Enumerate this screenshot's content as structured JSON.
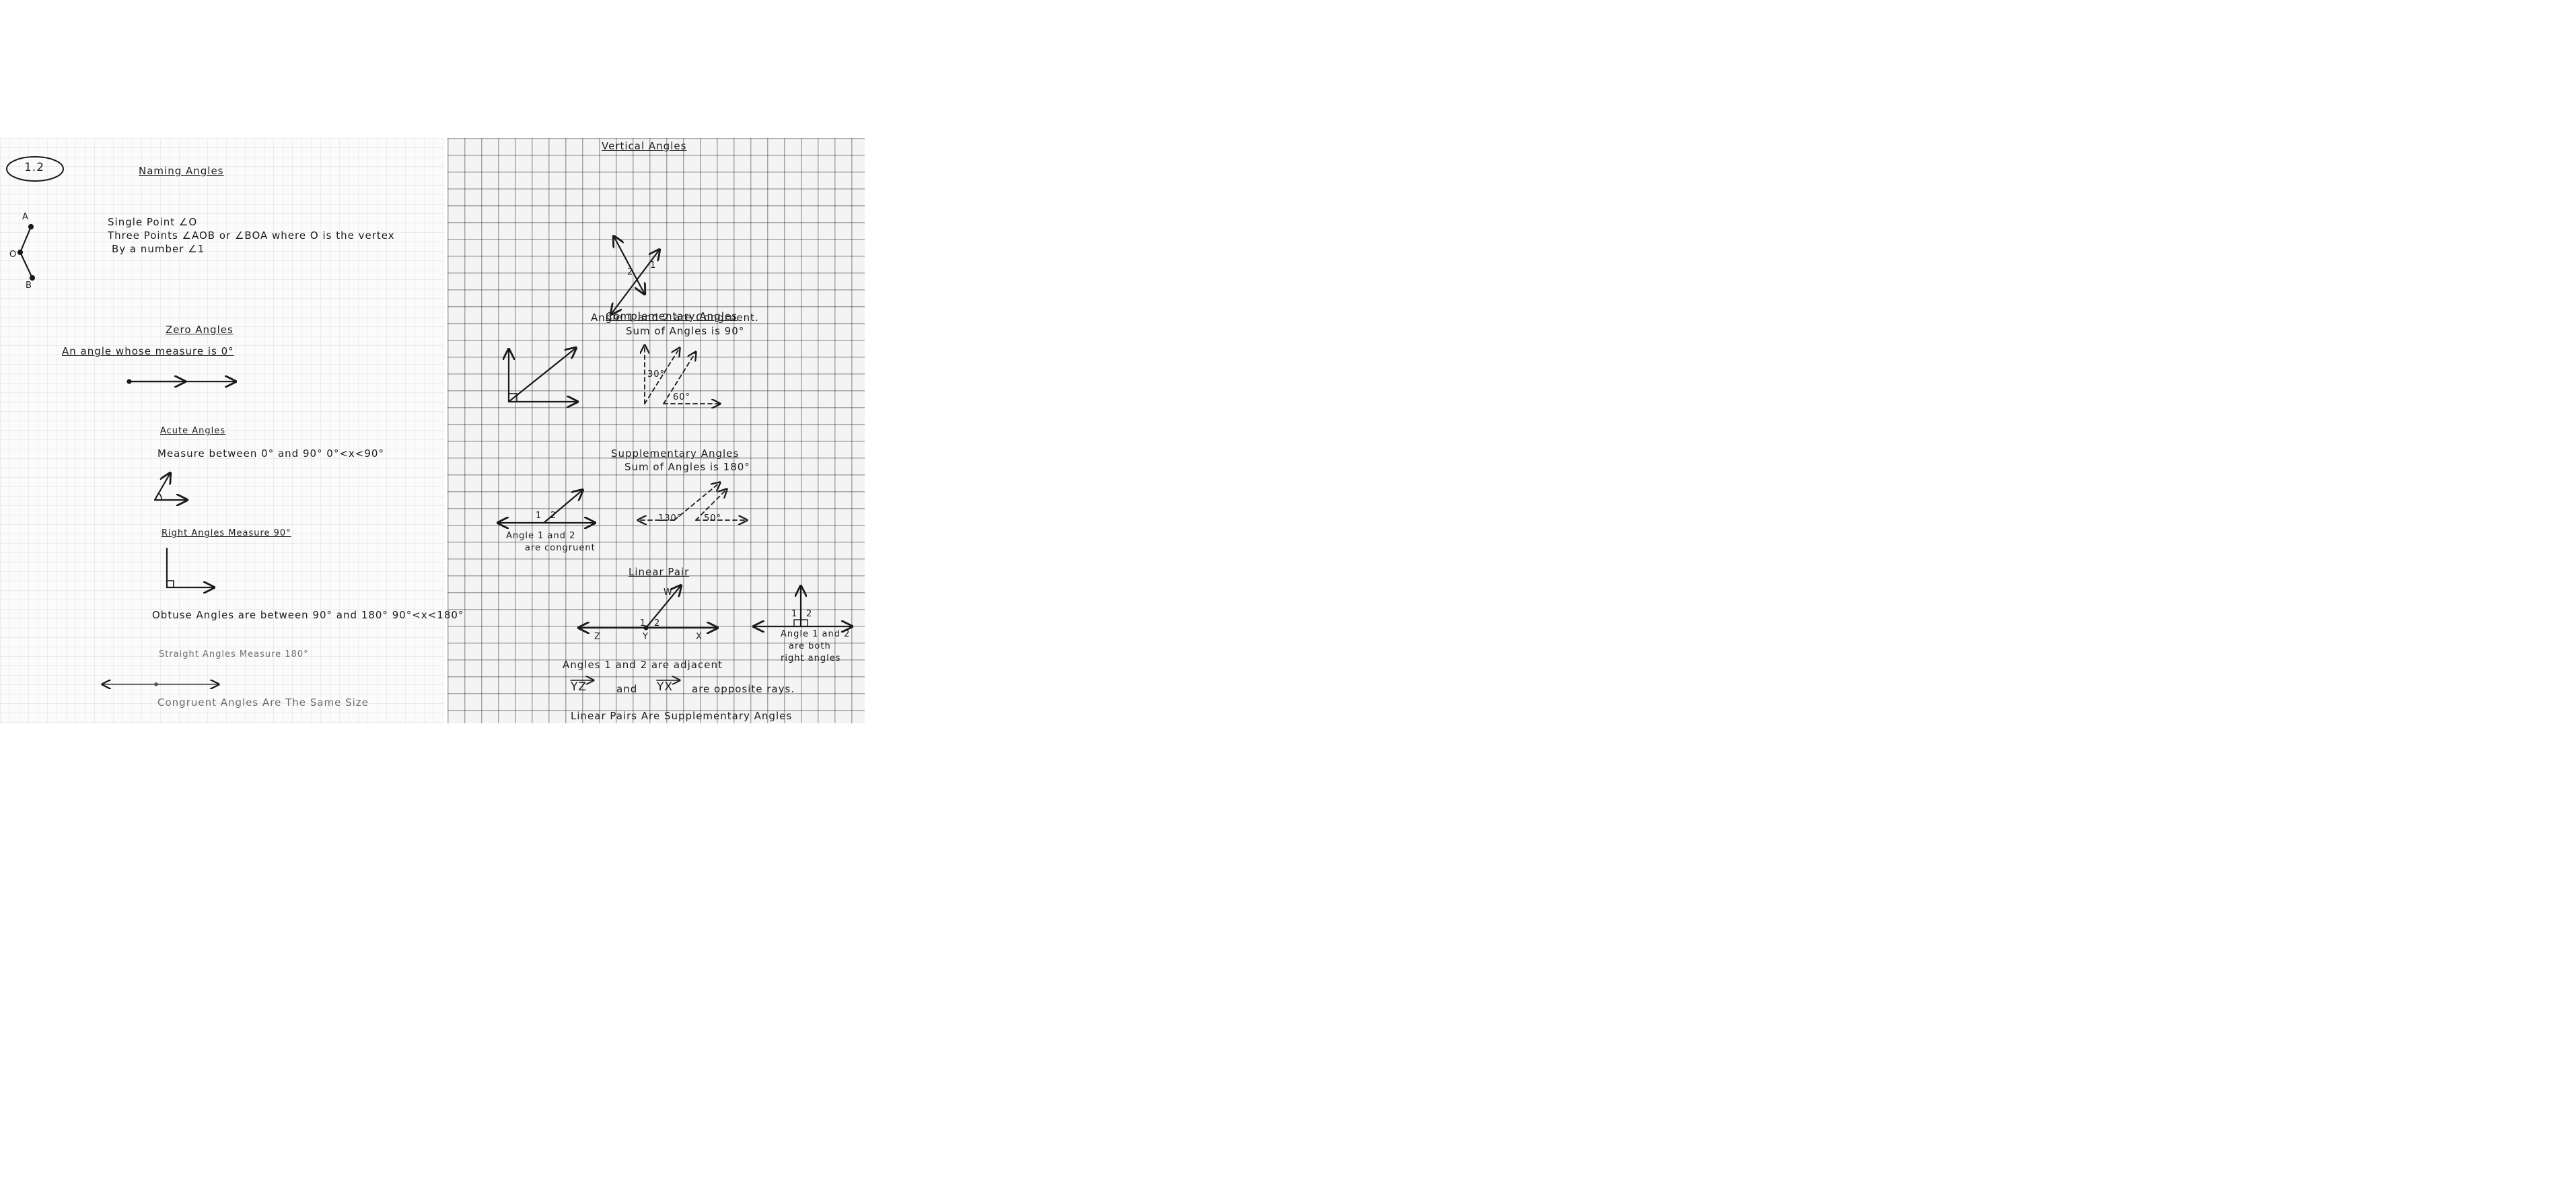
{
  "left": {
    "badge": "1.2",
    "title": "Naming Angles",
    "figure_labels": {
      "a": "A",
      "o": "O",
      "b": "B"
    },
    "naming": [
      "Single Point ∠O",
      "Three Points ∠AOB or ∠BOA where O is the vertex",
      "By a number ∠1"
    ],
    "zero_heading": "Zero Angles",
    "zero_text": "An angle whose measure is 0°",
    "acute_heading": "Acute Angles",
    "acute_text": "Measure between 0° and 90° 0°<x<90°",
    "right_heading": "Right Angles Measure 90°",
    "obtuse_text": "Obtuse Angles are between 90° and 180° 90°<x<180°",
    "straight_text": "Straight Angles Measure 180°",
    "congruent_text": "Congruent Angles Are The Same Size"
  },
  "right": {
    "vertical_heading": "Vertical Angles",
    "vertical_labels": {
      "one": "1",
      "two": "2"
    },
    "vertical_text": "Angle 1 and 2 are Congruent.",
    "comp_heading": "Complementary Angles",
    "comp_sub": "Sum of Angles is 90°",
    "comp_labels": {
      "a": "30°",
      "b": "60°"
    },
    "supp_heading": "Supplementary Angles",
    "supp_sub": "Sum of Angles is 180°",
    "supp_figure_labels": {
      "one": "1",
      "two": "2"
    },
    "supp_caption": [
      "Angle 1 and 2",
      "are congruent"
    ],
    "supp_labels": {
      "a": "130°",
      "b": "50°"
    },
    "linear_heading": "Linear Pair",
    "linear_points": {
      "w": "W",
      "z": "Z",
      "y": "Y",
      "x": "X",
      "one": "1",
      "two": "2"
    },
    "linear_right_labels": {
      "one": "1",
      "two": "2"
    },
    "linear_caption": [
      "Angle 1 and 2",
      "are both",
      "right angles"
    ],
    "adjacent_text": "Angles 1 and 2 are adjacent",
    "rays": {
      "a": "YZ",
      "and": "and",
      "b": "YX",
      "tail": "are opposite rays."
    },
    "bottom_text": "Linear Pairs Are Supplementary Angles"
  }
}
